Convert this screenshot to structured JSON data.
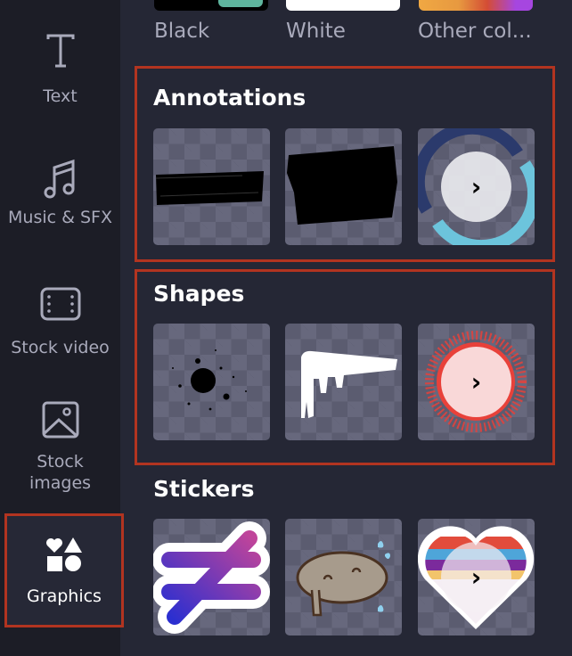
{
  "sidebar": {
    "items": [
      {
        "label": "Text",
        "icon": "text-icon",
        "active": false
      },
      {
        "label": "Music & SFX",
        "icon": "music-icon",
        "active": false
      },
      {
        "label": "Stock video",
        "icon": "film-icon",
        "active": false
      },
      {
        "label": "Stock images",
        "icon": "image-icon",
        "active": false
      },
      {
        "label": "Graphics",
        "icon": "shapes-icon",
        "active": true
      }
    ]
  },
  "backgrounds": {
    "swatches": [
      {
        "label": "Black",
        "color": "#000000",
        "accent": "#5fb59e"
      },
      {
        "label": "White",
        "color": "#ffffff"
      },
      {
        "label": "Other col...",
        "gradient": [
          "#f0a843",
          "#d44d34",
          "#a646e0"
        ]
      }
    ]
  },
  "sections": [
    {
      "title": "Annotations",
      "highlighted": true,
      "items": [
        {
          "name": "thin-brush-stroke",
          "color": "#000000"
        },
        {
          "name": "thick-brush-stroke",
          "color": "#000000"
        },
        {
          "name": "circular-arrows",
          "colors": [
            "#2b3a6c",
            "#6cc4dc"
          ],
          "more": true
        }
      ]
    },
    {
      "title": "Shapes",
      "highlighted": true,
      "items": [
        {
          "name": "ink-splatter",
          "color": "#000000"
        },
        {
          "name": "paint-drip",
          "color": "#ffffff"
        },
        {
          "name": "halftone-circle",
          "color": "#e8413a",
          "more": true
        }
      ]
    },
    {
      "title": "Stickers",
      "highlighted": false,
      "items": [
        {
          "name": "not-equal-sticker",
          "colors": [
            "#c0449a",
            "#2b2fd0"
          ]
        },
        {
          "name": "pusheen-cat-sticker",
          "color": "#a79b8c"
        },
        {
          "name": "rainbow-heart-sticker",
          "colors": [
            "#e24c3c",
            "#4ea5d9",
            "#7b2a9c",
            "#f2c46b"
          ],
          "more": true
        }
      ]
    }
  ],
  "more_glyph": "›",
  "colors": {
    "background": "#252735",
    "sidebar": "#1c1d26",
    "highlight_border": "#b23420",
    "label_text": "#a9aabb"
  }
}
